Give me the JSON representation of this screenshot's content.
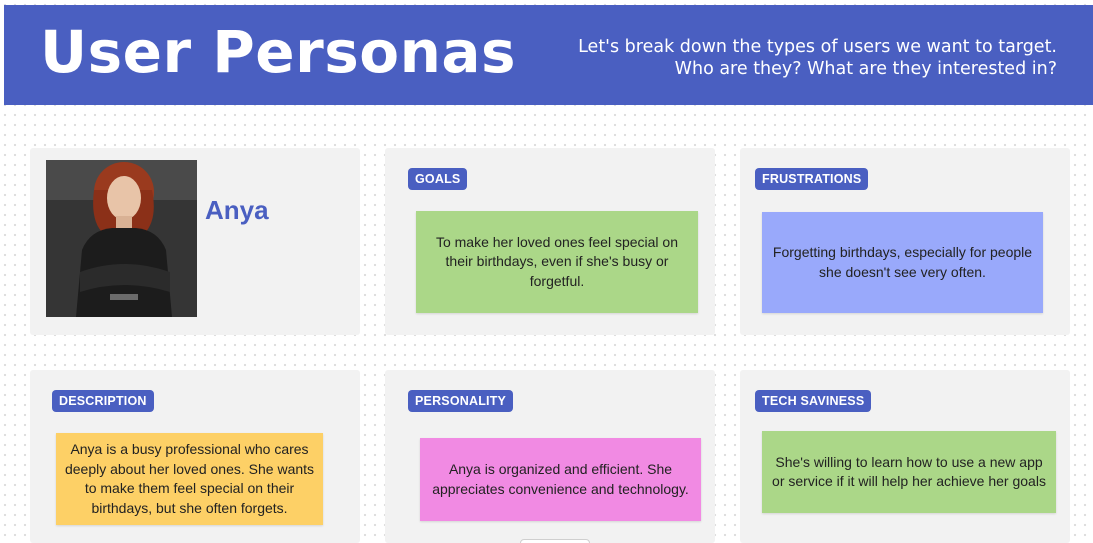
{
  "header": {
    "title": "User Personas",
    "subtitle_line1": "Let's break down the types of users we want to target.",
    "subtitle_line2": "Who are they? What are they interested in?",
    "background_color": "#4a5fc1"
  },
  "persona": {
    "name": "Anya",
    "photo_icon": "persona-photo"
  },
  "goals": {
    "tag": "GOALS",
    "text": "To make her loved ones feel special on their birthdays, even if she's busy or forgetful.",
    "note_color": "#abd788"
  },
  "frustrations": {
    "tag": "FRUSTRATIONS",
    "text": "Forgetting birthdays, especially for people she doesn't see very often.",
    "note_color": "#99a9fb"
  },
  "description": {
    "tag": "DESCRIPTION",
    "text": "Anya is a busy professional who cares deeply about her loved ones. She wants to make them feel special on their birthdays, but she often forgets.",
    "note_color": "#fdd066"
  },
  "personality": {
    "tag": "PERSONALITY",
    "text": "Anya is organized and efficient. She appreciates convenience and technology.",
    "note_color": "#f18ae3"
  },
  "tech_saviness": {
    "tag": "TECH SAVINESS",
    "text": "She's willing to learn how to use a new app or service if it will help her achieve her goals",
    "note_color": "#abd788"
  }
}
